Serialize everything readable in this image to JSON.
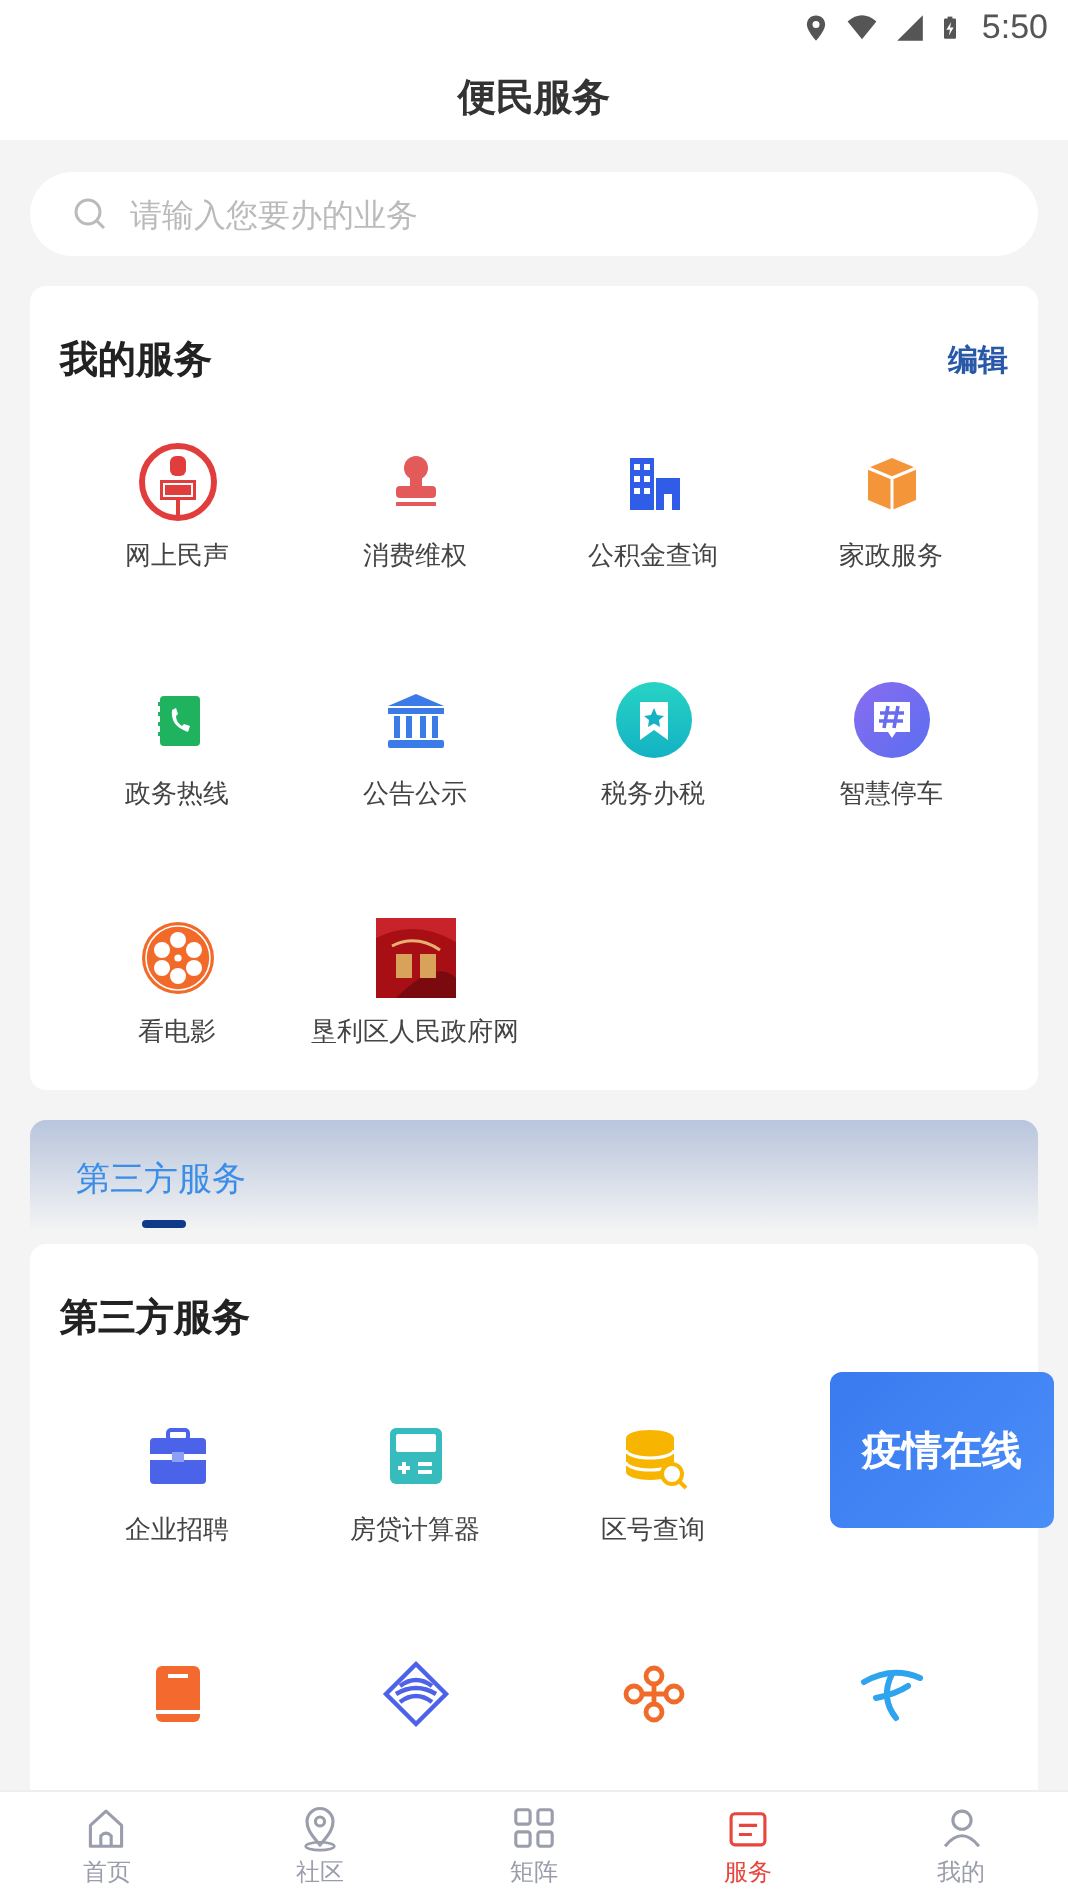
{
  "status_bar": {
    "time": "5:50"
  },
  "header": {
    "title": "便民服务"
  },
  "search": {
    "placeholder": "请输入您要办的业务"
  },
  "my_services": {
    "title": "我的服务",
    "edit": "编辑",
    "items": [
      {
        "label": "网上民声"
      },
      {
        "label": "消费维权"
      },
      {
        "label": "公积金查询"
      },
      {
        "label": "家政服务"
      },
      {
        "label": "政务热线"
      },
      {
        "label": "公告公示"
      },
      {
        "label": "税务办税"
      },
      {
        "label": "智慧停车"
      },
      {
        "label": "看电影"
      },
      {
        "label": "垦利区人民政府网",
        "kind": "picture"
      }
    ]
  },
  "tabs": [
    {
      "label": "第三方服务",
      "selected": true
    }
  ],
  "third_party": {
    "title": "第三方服务",
    "items": [
      {
        "label": "企业招聘"
      },
      {
        "label": "房贷计算器"
      },
      {
        "label": "区号查询"
      },
      {
        "kind": "icon"
      },
      {
        "kind": "icon"
      },
      {
        "kind": "icon"
      },
      {
        "kind": "icon"
      }
    ]
  },
  "banner": {
    "text": "疫情在线"
  },
  "bottom_nav": [
    {
      "label": "首页",
      "selected": false
    },
    {
      "label": "社区",
      "selected": false
    },
    {
      "label": "矩阵",
      "selected": false
    },
    {
      "label": "服务",
      "selected": true
    },
    {
      "label": "我的",
      "selected": false
    }
  ]
}
